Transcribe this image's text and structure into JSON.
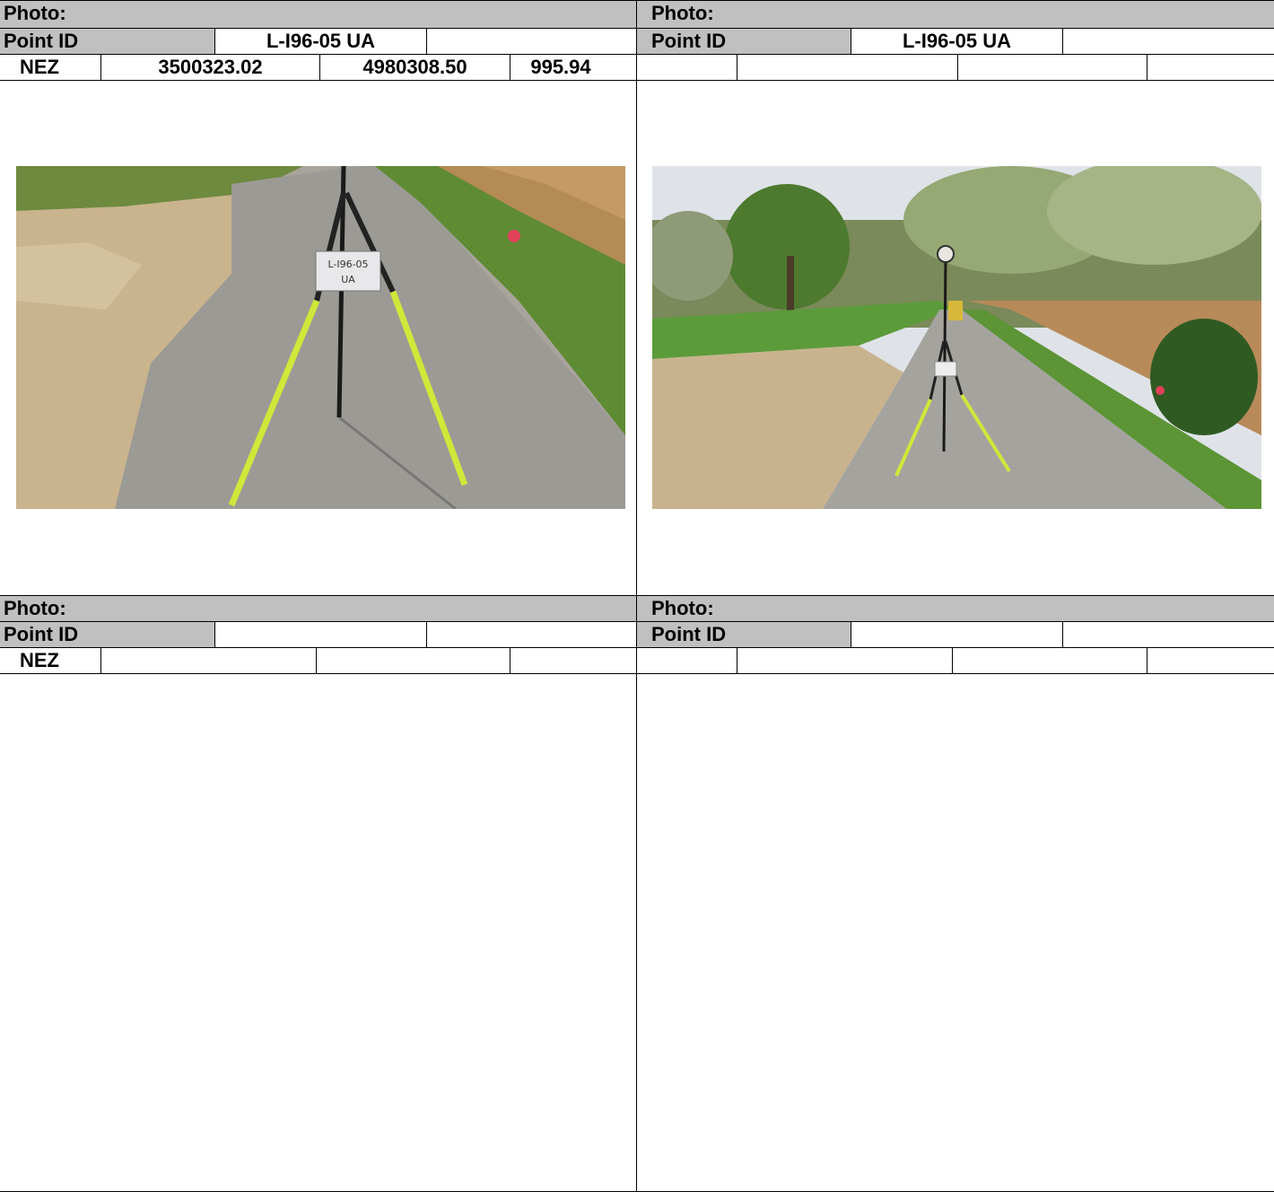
{
  "panels": [
    {
      "photo_label": "Photo:",
      "point_id_label": "Point ID",
      "point_id": "L-I96-05 UA",
      "nez_label": "NEZ",
      "nez": [
        "3500323.02",
        "4980308.50",
        "995.94"
      ],
      "image": {
        "alt": "Close-up of survey tripod over point on gravel road",
        "sign_text_1": "L-I96-05",
        "sign_text_2": "UA"
      }
    },
    {
      "photo_label": "Photo:",
      "point_id_label": "Point ID",
      "point_id": "L-I96-05 UA",
      "nez_label": "",
      "nez": [
        "",
        "",
        ""
      ],
      "image": {
        "alt": "Wide view of GPS receiver on tripod over gravel road with trees"
      }
    },
    {
      "photo_label": "Photo:",
      "point_id_label": "Point ID",
      "point_id": "",
      "nez_label": "NEZ",
      "nez": [
        "",
        "",
        ""
      ]
    },
    {
      "photo_label": "Photo:",
      "point_id_label": "Point ID",
      "point_id": "",
      "nez_label": "",
      "nez": [
        "",
        "",
        ""
      ]
    }
  ],
  "colors": {
    "header_gray": "#c0c0c0",
    "grid": "#000000"
  }
}
